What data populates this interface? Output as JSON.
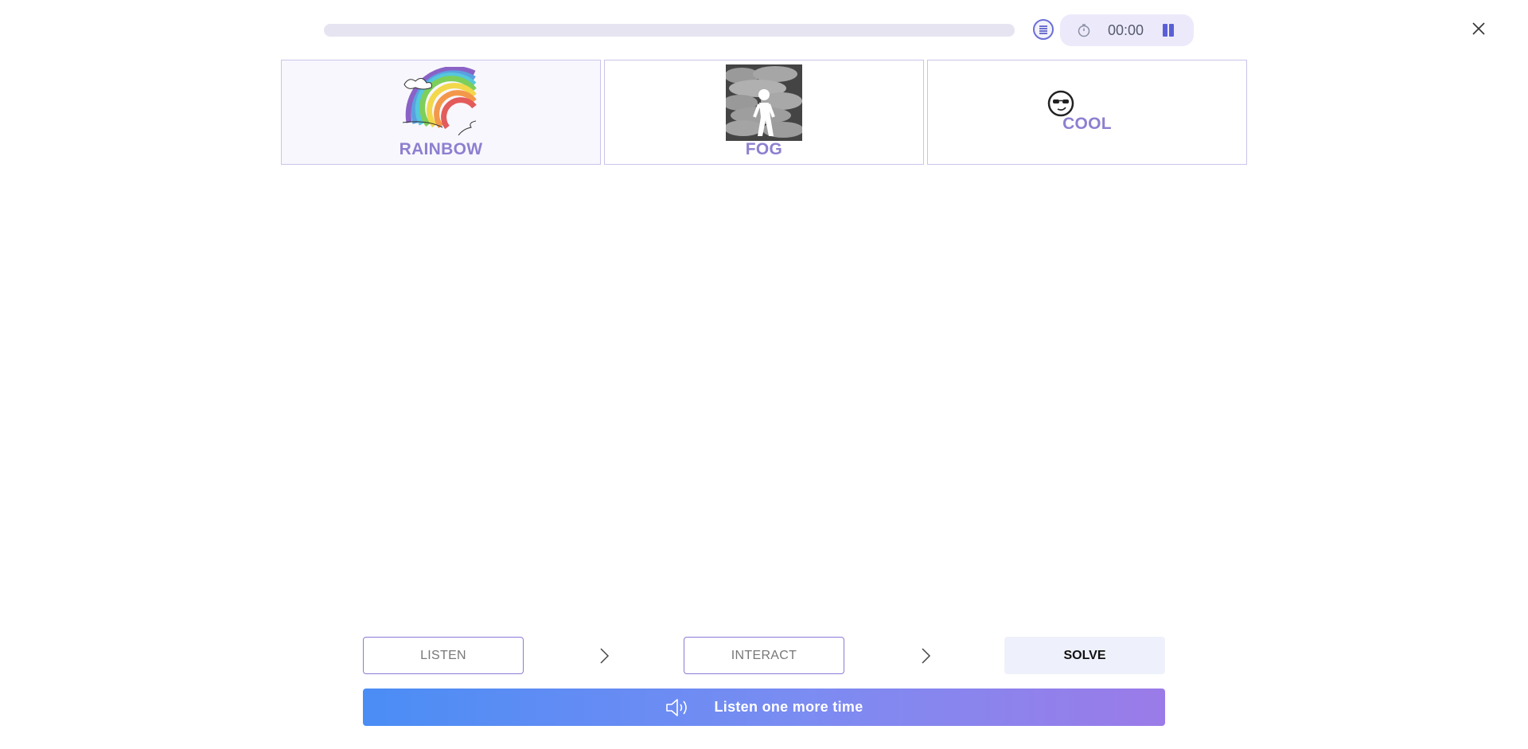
{
  "header": {
    "progress_fraction": 0,
    "timer": "00:00",
    "icons": {
      "list": "list-icon",
      "timer": "stopwatch-icon",
      "pause": "pause-icon",
      "close": "close-icon"
    }
  },
  "cards": [
    {
      "label": "RAINBOW",
      "icon": "rainbow-picture"
    },
    {
      "label": "FOG",
      "icon": "fog-picture"
    },
    {
      "label": "COOL",
      "icon": "cool-face-icon"
    }
  ],
  "steps": {
    "listen": "LISTEN",
    "interact": "INTERACT",
    "solve": "SOLVE"
  },
  "listen_again": {
    "label": "Listen one more time",
    "icon": "speaker-icon"
  },
  "colors": {
    "accent": "#8e7fd0",
    "progress_track": "#e6e4f1",
    "button_gradient_start": "#4a8df5",
    "button_gradient_end": "#9b7be8"
  }
}
